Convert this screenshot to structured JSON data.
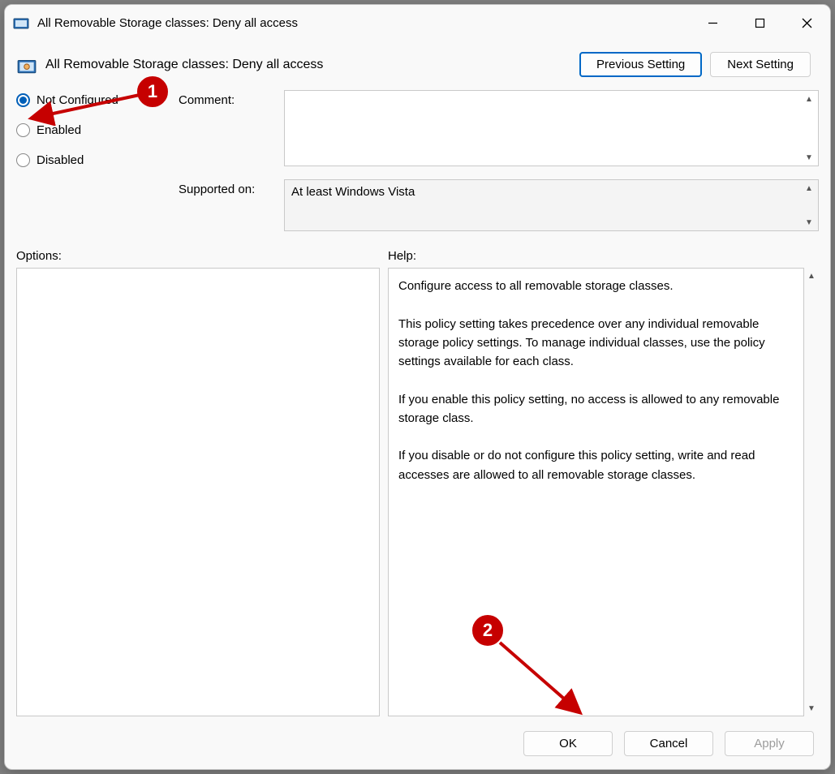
{
  "window": {
    "title": "All Removable Storage classes: Deny all access"
  },
  "header": {
    "title": "All Removable Storage classes: Deny all access",
    "previous_setting": "Previous Setting",
    "next_setting": "Next Setting"
  },
  "radios": {
    "not_configured": "Not Configured",
    "enabled": "Enabled",
    "disabled": "Disabled"
  },
  "labels": {
    "comment": "Comment:",
    "supported_on": "Supported on:",
    "options": "Options:",
    "help": "Help:"
  },
  "comment_value": "",
  "supported_value": "At least Windows Vista",
  "help_text": {
    "p1": "Configure access to all removable storage classes.",
    "p2": "This policy setting takes precedence over any individual removable storage policy settings. To manage individual classes, use the policy settings available for each class.",
    "p3": "If you enable this policy setting, no access is allowed to any removable storage class.",
    "p4": "If you disable or do not configure this policy setting, write and read accesses are allowed to all removable storage classes."
  },
  "footer": {
    "ok": "OK",
    "cancel": "Cancel",
    "apply": "Apply"
  },
  "callouts": {
    "one": "1",
    "two": "2"
  }
}
